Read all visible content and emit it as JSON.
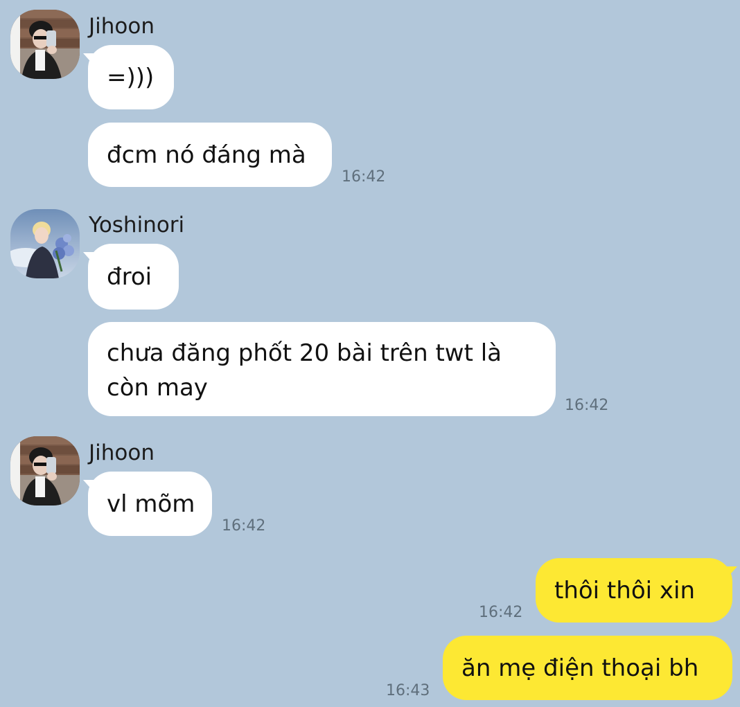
{
  "messages": [
    {
      "sender": "Jihoon",
      "bubbles": [
        {
          "text": "=)))"
        },
        {
          "text": "đcm nó đáng mà",
          "time": "16:42"
        }
      ]
    },
    {
      "sender": "Yoshinori",
      "bubbles": [
        {
          "text": "đroi"
        },
        {
          "text": "chưa đăng phốt 20 bài trên twt là còn may",
          "time": "16:42"
        }
      ]
    },
    {
      "sender": "Jihoon",
      "bubbles": [
        {
          "text": "vl mõm",
          "time": "16:42"
        }
      ]
    }
  ],
  "own_messages": [
    {
      "text": "thôi thôi xin",
      "time": "16:42"
    },
    {
      "text": "ăn mẹ điện thoại bh",
      "time": "16:43"
    }
  ],
  "colors": {
    "background": "#b2c7da",
    "incoming_bubble": "#ffffff",
    "outgoing_bubble": "#fde833",
    "timestamp": "#5f6f7c"
  },
  "icons": {
    "jihoon_avatar": "profile-photo-selfie",
    "yoshinori_avatar": "profile-photo-flowers"
  }
}
